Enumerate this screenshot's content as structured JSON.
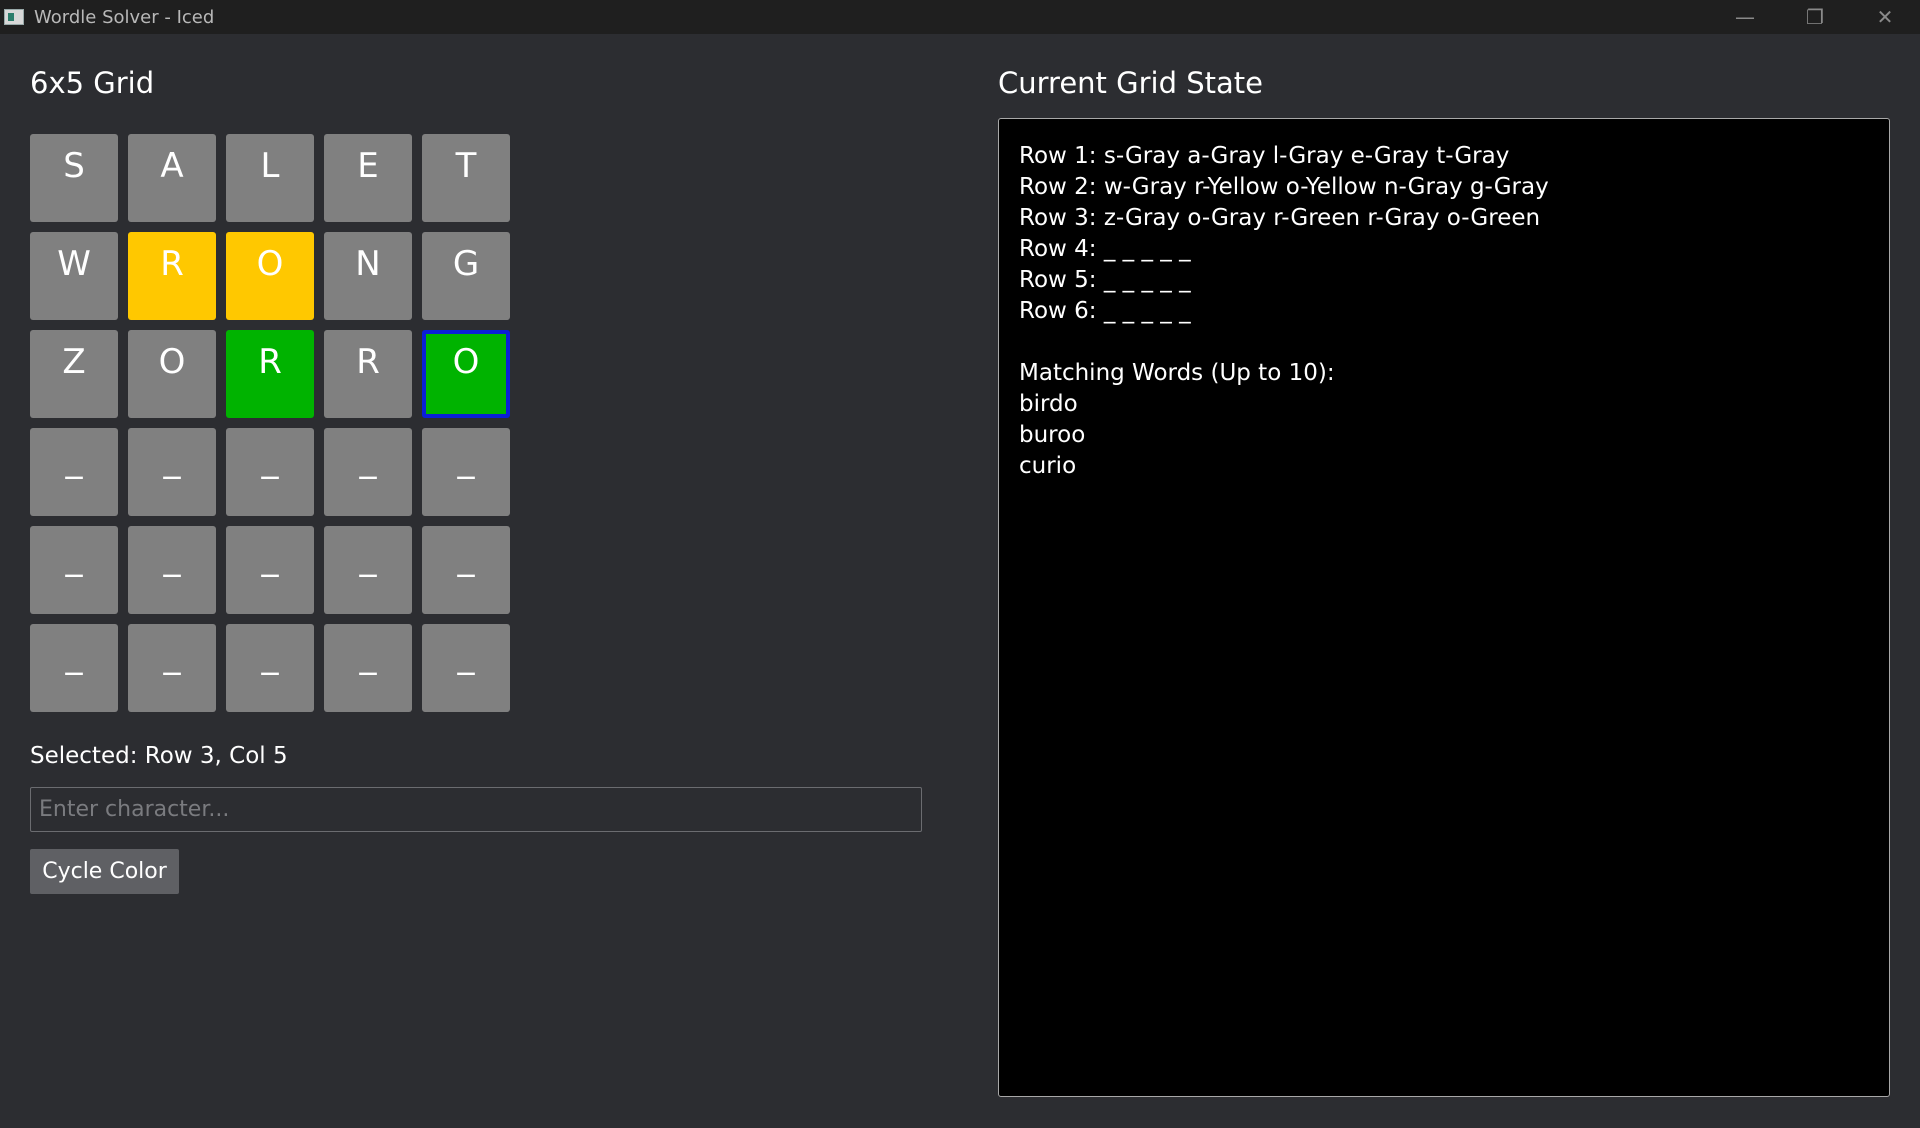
{
  "window": {
    "title": "Wordle Solver - Iced",
    "controls": {
      "minimize": "—",
      "maximize": "❐",
      "close": "✕"
    }
  },
  "colors": {
    "gray": "#808080",
    "yellow": "#ffc800",
    "green": "#00b300",
    "selection_border": "#0a1fd8",
    "background": "#2c2d31"
  },
  "left": {
    "title": "6x5 Grid",
    "grid": [
      [
        {
          "letter": "S",
          "color": "gray"
        },
        {
          "letter": "A",
          "color": "gray"
        },
        {
          "letter": "L",
          "color": "gray"
        },
        {
          "letter": "E",
          "color": "gray"
        },
        {
          "letter": "T",
          "color": "gray"
        }
      ],
      [
        {
          "letter": "W",
          "color": "gray"
        },
        {
          "letter": "R",
          "color": "yellow"
        },
        {
          "letter": "O",
          "color": "yellow"
        },
        {
          "letter": "N",
          "color": "gray"
        },
        {
          "letter": "G",
          "color": "gray"
        }
      ],
      [
        {
          "letter": "Z",
          "color": "gray"
        },
        {
          "letter": "O",
          "color": "gray"
        },
        {
          "letter": "R",
          "color": "green"
        },
        {
          "letter": "R",
          "color": "gray"
        },
        {
          "letter": "O",
          "color": "green",
          "selected": true
        }
      ],
      [
        {
          "letter": "_",
          "color": "gray"
        },
        {
          "letter": "_",
          "color": "gray"
        },
        {
          "letter": "_",
          "color": "gray"
        },
        {
          "letter": "_",
          "color": "gray"
        },
        {
          "letter": "_",
          "color": "gray"
        }
      ],
      [
        {
          "letter": "_",
          "color": "gray"
        },
        {
          "letter": "_",
          "color": "gray"
        },
        {
          "letter": "_",
          "color": "gray"
        },
        {
          "letter": "_",
          "color": "gray"
        },
        {
          "letter": "_",
          "color": "gray"
        }
      ],
      [
        {
          "letter": "_",
          "color": "gray"
        },
        {
          "letter": "_",
          "color": "gray"
        },
        {
          "letter": "_",
          "color": "gray"
        },
        {
          "letter": "_",
          "color": "gray"
        },
        {
          "letter": "_",
          "color": "gray"
        }
      ]
    ],
    "selected_label": "Selected: Row 3, Col 5",
    "input": {
      "placeholder": "Enter character...",
      "value": ""
    },
    "cycle_button": "Cycle Color"
  },
  "right": {
    "title": "Current Grid State",
    "lines": [
      "Row 1: s-Gray a-Gray l-Gray e-Gray t-Gray",
      "Row 2: w-Gray r-Yellow o-Yellow n-Gray g-Gray",
      "Row 3: z-Gray o-Gray r-Green r-Gray o-Green",
      "Row 4: _ _ _ _ _",
      "Row 5: _ _ _ _ _",
      "Row 6: _ _ _ _ _",
      "",
      "Matching Words (Up to 10):",
      "birdo",
      "buroo",
      "curio"
    ]
  }
}
